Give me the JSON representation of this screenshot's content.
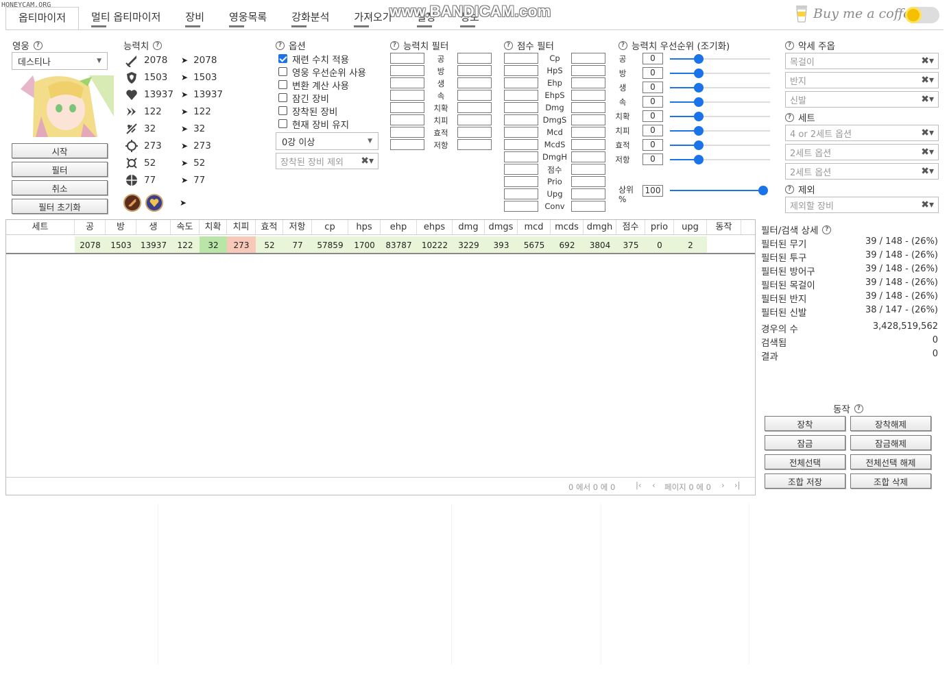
{
  "watermark": {
    "small": "HONEYCAM.ORG",
    "big": "www.BANDICAM.com"
  },
  "tabs": [
    {
      "label": "옵티마이저",
      "active": true
    },
    {
      "label": "멀티 옵티마이저"
    },
    {
      "label": "장비"
    },
    {
      "label": "영웅목록"
    },
    {
      "label": "강화분석"
    },
    {
      "label": "가져오기"
    },
    {
      "label": "설정"
    },
    {
      "label": "정보"
    }
  ],
  "coffee": {
    "label": "Buy me a coffee"
  },
  "hero": {
    "header": "영웅",
    "selected": "데스티나"
  },
  "left_buttons": {
    "start": "시작",
    "filter": "필터",
    "cancel": "취소",
    "reset": "필터 초기화"
  },
  "stats": {
    "header": "능력치",
    "rows": [
      {
        "icon": "attack-icon",
        "base": "2078",
        "total": "2078"
      },
      {
        "icon": "defense-icon",
        "base": "1503",
        "total": "1503"
      },
      {
        "icon": "health-icon",
        "base": "13937",
        "total": "13937"
      },
      {
        "icon": "speed-icon",
        "base": "122",
        "total": "122"
      },
      {
        "icon": "crit-chance-icon",
        "base": "32",
        "total": "32"
      },
      {
        "icon": "crit-damage-icon",
        "base": "273",
        "total": "273"
      },
      {
        "icon": "effectiveness-icon",
        "base": "52",
        "total": "52"
      },
      {
        "icon": "effect-resistance-icon",
        "base": "77",
        "total": "77"
      }
    ]
  },
  "options": {
    "header": "옵션",
    "checkboxes": [
      {
        "label": "재련 수치 적용",
        "checked": true
      },
      {
        "label": "영웅 우선순위 사용",
        "checked": false
      },
      {
        "label": "변환 계산 사용",
        "checked": false
      },
      {
        "label": "잠긴 장비",
        "checked": false
      },
      {
        "label": "장착된 장비",
        "checked": false
      },
      {
        "label": "현재 장비 유지",
        "checked": false
      }
    ],
    "enhance_select": "0강 이상",
    "exclude_equipped": "장착된 장비 제외"
  },
  "stat_filter": {
    "header": "능력치 필터",
    "labels": [
      "공",
      "방",
      "생",
      "속",
      "치확",
      "치피",
      "효적",
      "저항"
    ]
  },
  "score_filter": {
    "header": "점수 필터",
    "labels": [
      "Cp",
      "HpS",
      "Ehp",
      "EhpS",
      "Dmg",
      "DmgS",
      "Mcd",
      "McdS",
      "DmgH",
      "점수",
      "Prio",
      "Upg",
      "Conv"
    ]
  },
  "priority": {
    "header": "능력치 우선순위 (조기화)",
    "rows": [
      {
        "label": "공",
        "value": "0",
        "fraction": 0.29
      },
      {
        "label": "방",
        "value": "0",
        "fraction": 0.29
      },
      {
        "label": "생",
        "value": "0",
        "fraction": 0.29
      },
      {
        "label": "속",
        "value": "0",
        "fraction": 0.29
      },
      {
        "label": "치확",
        "value": "0",
        "fraction": 0.29
      },
      {
        "label": "치피",
        "value": "0",
        "fraction": 0.29
      },
      {
        "label": "효적",
        "value": "0",
        "fraction": 0.29
      },
      {
        "label": "저항",
        "value": "0",
        "fraction": 0.29
      }
    ],
    "top_label": "상위",
    "top_unit": "%",
    "top_value": "100",
    "top_fraction": 1.0
  },
  "accessory": {
    "header": "악세 주옵",
    "necklace": "목걸이",
    "ring": "반지",
    "boots": "신발",
    "set_header": "세트",
    "set1": "4 or 2세트 옵션",
    "set2": "2세트 옵션",
    "set3": "2세트 옵션",
    "exclude_header": "제외",
    "exclude_placeholder": "제외할 장비"
  },
  "table": {
    "columns": [
      "세트",
      "공",
      "방",
      "생",
      "속도",
      "치확",
      "치피",
      "효적",
      "저항",
      "cp",
      "hps",
      "ehp",
      "ehps",
      "dmg",
      "dmgs",
      "mcd",
      "mcds",
      "dmgh",
      "점수",
      "prio",
      "upg",
      "동작"
    ],
    "row": [
      "",
      "2078",
      "1503",
      "13937",
      "122",
      "32",
      "273",
      "52",
      "77",
      "57859",
      "1700",
      "83787",
      "10222",
      "3229",
      "393",
      "5675",
      "692",
      "3804",
      "375",
      "0",
      "2",
      ""
    ],
    "pager": {
      "range": "0 에서 0 에 0",
      "page": "페이지 0 에 0"
    }
  },
  "details": {
    "header": "필터/검색 상세",
    "rows": [
      {
        "label": "필터된 무기",
        "value": "39 / 148 - (26%)"
      },
      {
        "label": "필터된 투구",
        "value": "39 / 148 - (26%)"
      },
      {
        "label": "필터된 방어구",
        "value": "39 / 148 - (26%)"
      },
      {
        "label": "필터된 목걸이",
        "value": "39 / 148 - (26%)"
      },
      {
        "label": "필터된 반지",
        "value": "39 / 148 - (26%)"
      },
      {
        "label": "필터된 신발",
        "value": "38 / 147 - (26%)"
      }
    ],
    "cases_label": "경우의 수",
    "cases_value": "3,428,519,562",
    "searched_label": "검색됨",
    "searched_value": "0",
    "result_label": "결과",
    "result_value": "0"
  },
  "actions": {
    "header": "동작",
    "equip": "장착",
    "unequip": "장착해제",
    "lock": "잠금",
    "unlock": "잠금해제",
    "select_all": "전체선택",
    "deselect_all": "전체선택 해제",
    "save_combo": "조합 저장",
    "delete_combo": "조합 삭제"
  },
  "colors": {
    "accent": "#1a73e8",
    "row_green": "#e8f5d8",
    "crit_green": "#b9e6a6",
    "critdmg_red": "#f8c8b8"
  }
}
